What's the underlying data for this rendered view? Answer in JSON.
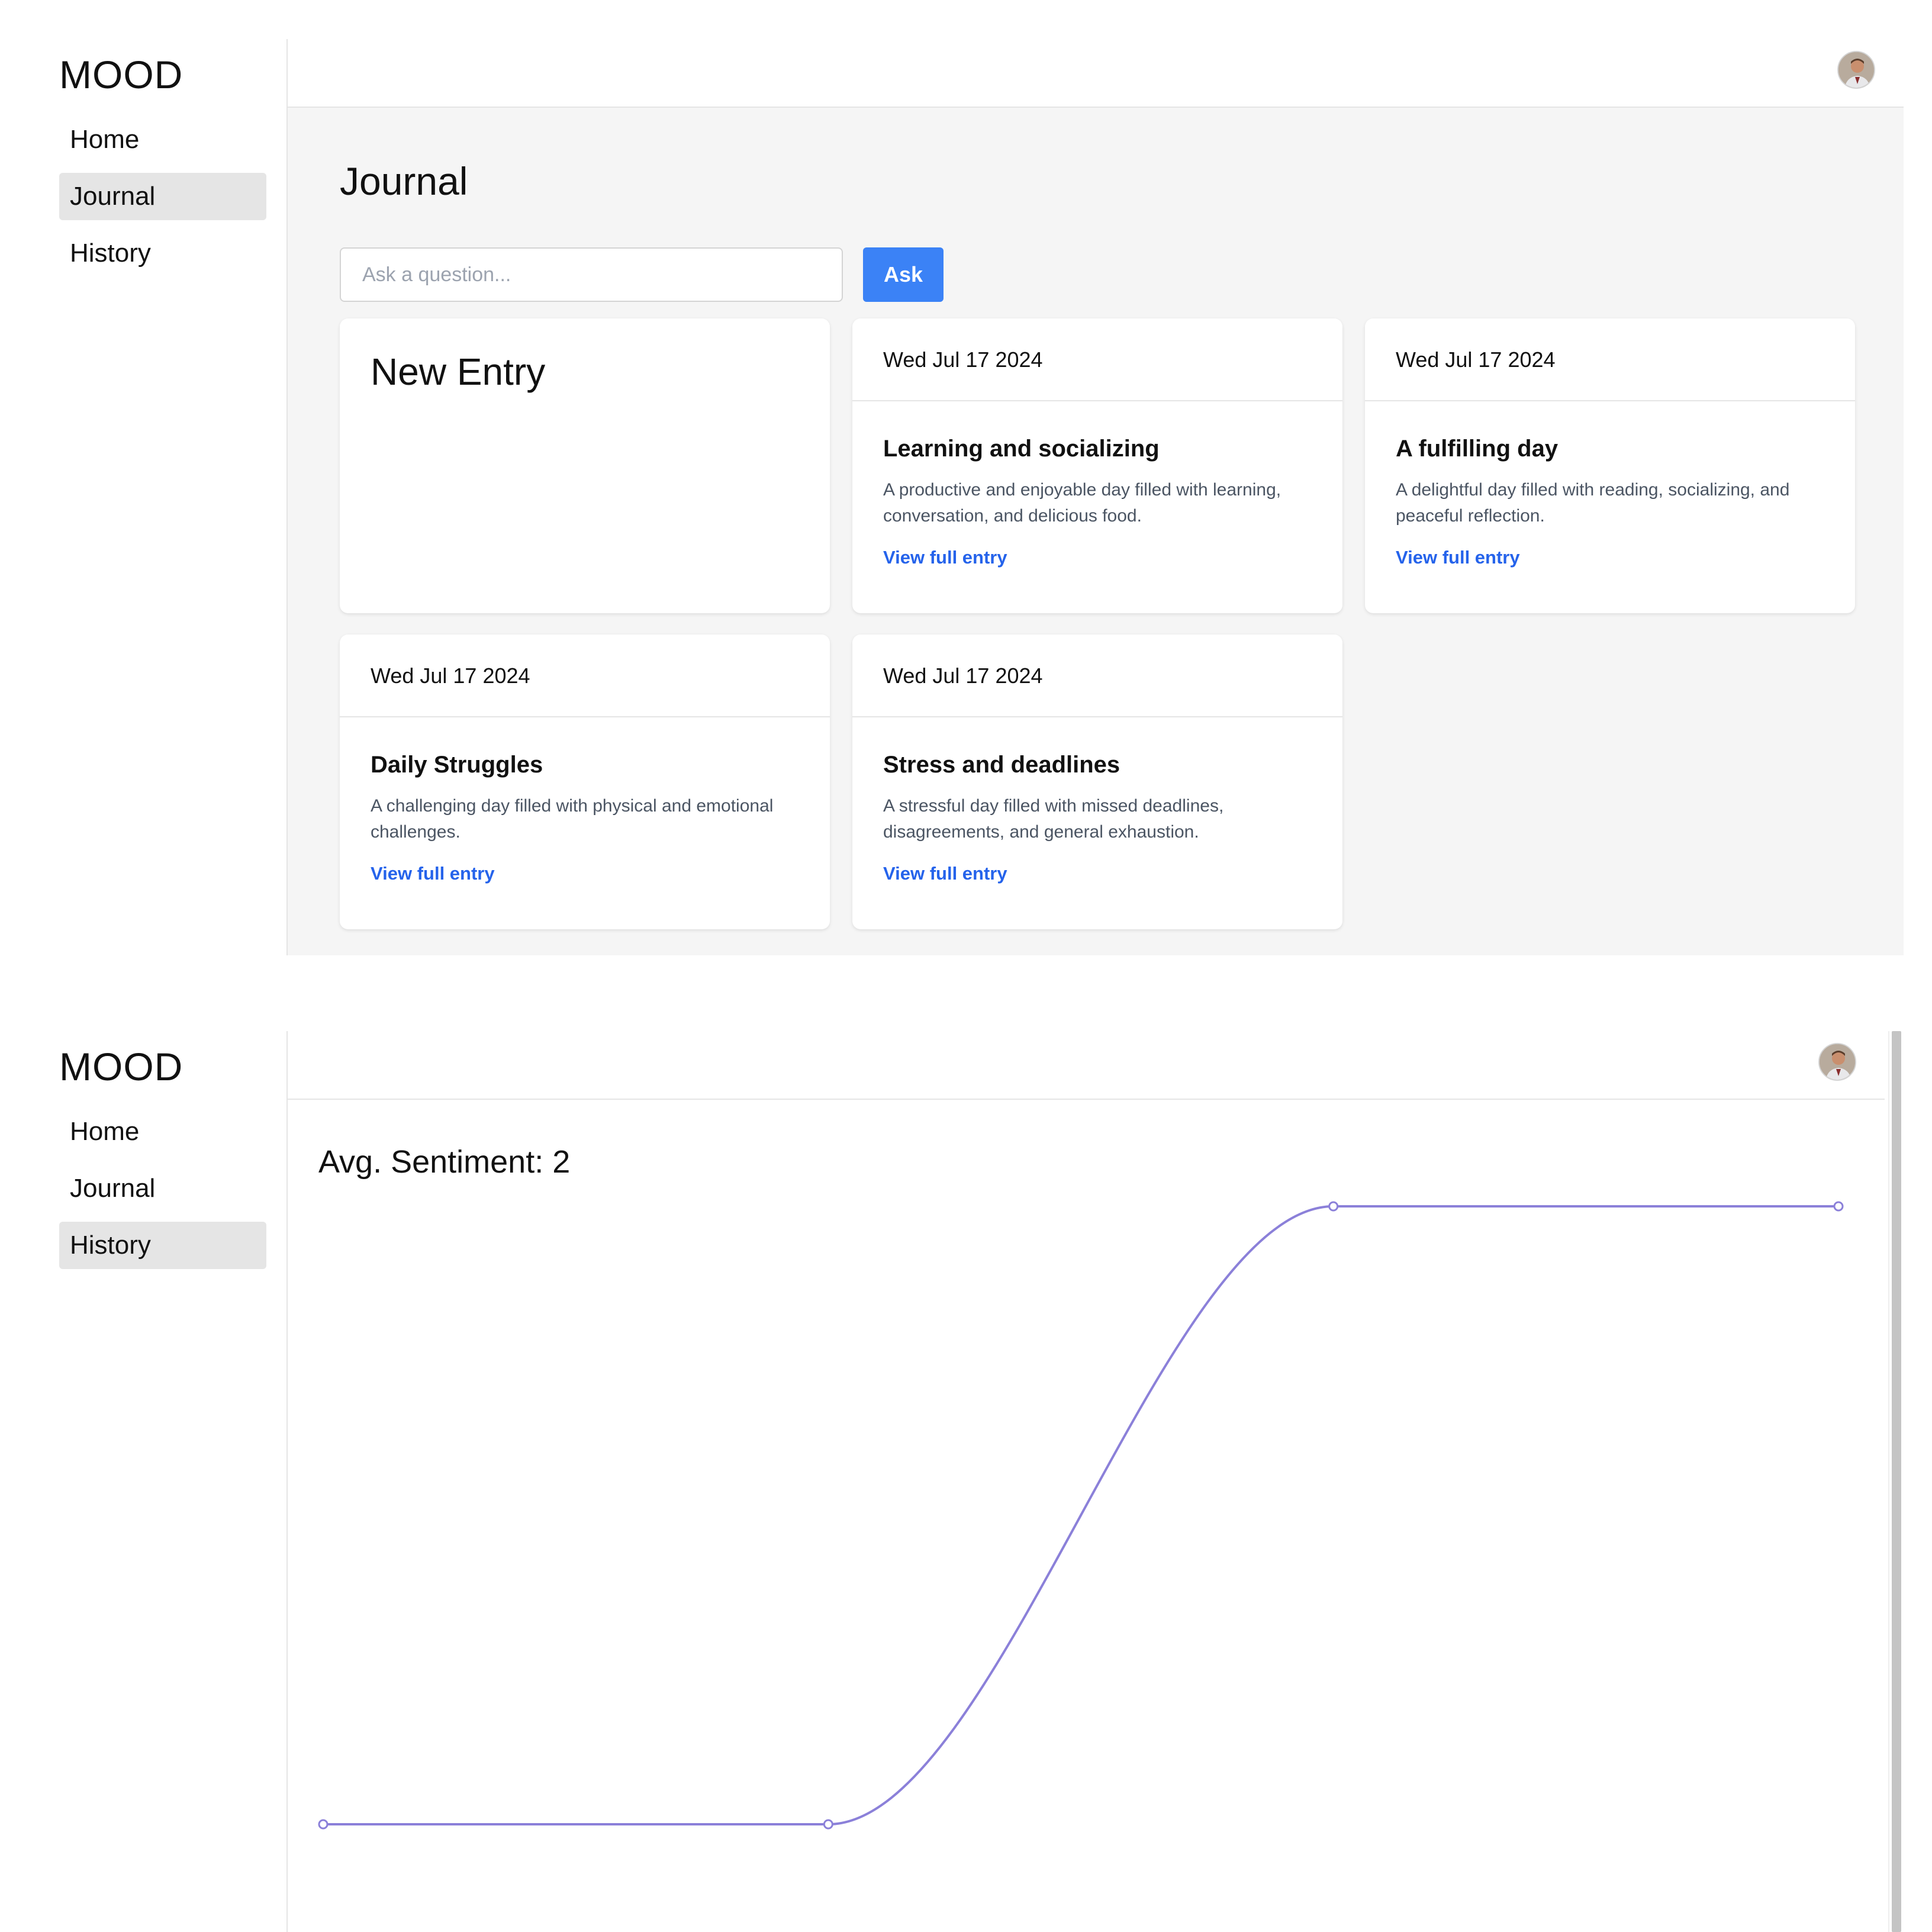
{
  "journal_screen": {
    "logo": "MOOD",
    "nav": [
      {
        "label": "Home",
        "active": false
      },
      {
        "label": "Journal",
        "active": true
      },
      {
        "label": "History",
        "active": false
      }
    ],
    "page_title": "Journal",
    "ask": {
      "placeholder": "Ask a question...",
      "button_label": "Ask"
    },
    "new_entry_label": "New Entry",
    "entries": [
      {
        "date": "Wed Jul 17 2024",
        "title": "Learning and socializing",
        "summary": "A productive and enjoyable day filled with learning, conversation, and delicious food.",
        "link": "View full entry"
      },
      {
        "date": "Wed Jul 17 2024",
        "title": "A fulfilling day",
        "summary": "A delightful day filled with reading, socializing, and peaceful reflection.",
        "link": "View full entry"
      },
      {
        "date": "Wed Jul 17 2024",
        "title": "Daily Struggles",
        "summary": "A challenging day filled with physical and emotional challenges.",
        "link": "View full entry"
      },
      {
        "date": "Wed Jul 17 2024",
        "title": "Stress and deadlines",
        "summary": "A stressful day filled with missed deadlines, disagreements, and general exhaustion.",
        "link": "View full entry"
      }
    ],
    "avatar_icon": "user-avatar"
  },
  "history_screen": {
    "logo": "MOOD",
    "nav": [
      {
        "label": "Home",
        "active": false
      },
      {
        "label": "Journal",
        "active": false
      },
      {
        "label": "History",
        "active": true
      }
    ],
    "sentiment_label": "Avg. Sentiment: 2",
    "avatar_icon": "user-avatar"
  },
  "colors": {
    "accent": "#3b82f6",
    "link": "#2563eb",
    "line": "#8b80d9",
    "nav_active_bg": "#e5e5e5",
    "content_bg": "#f5f5f5"
  },
  "chart_data": {
    "type": "line",
    "title": "",
    "xlabel": "",
    "ylabel": "",
    "x": [
      1,
      2,
      3,
      4
    ],
    "series": [
      {
        "values": [
          -5,
          -5,
          8,
          8
        ]
      }
    ],
    "curve": "monotone",
    "show_points": true,
    "grid": false,
    "axes_visible": false
  }
}
